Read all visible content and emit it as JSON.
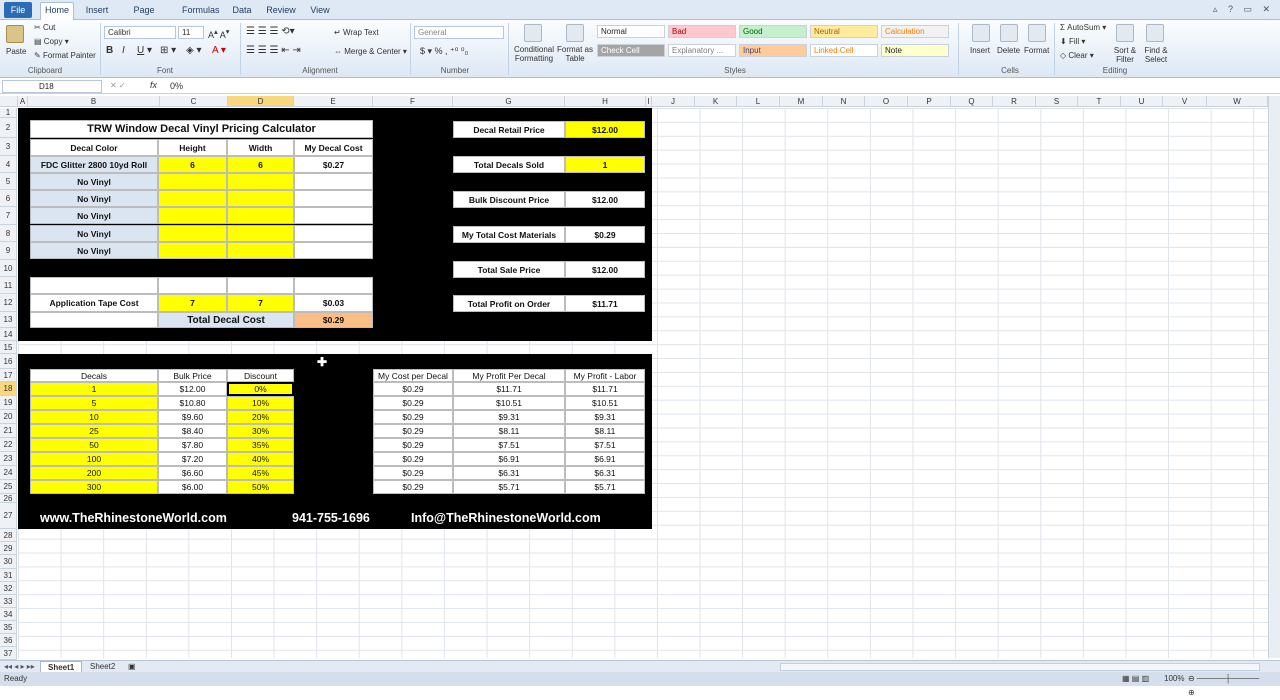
{
  "ribbon_tabs": {
    "file": "File",
    "home": "Home",
    "insert": "Insert",
    "page_layout": "Page Layout",
    "formulas": "Formulas",
    "data": "Data",
    "review": "Review",
    "view": "View"
  },
  "ribbon": {
    "paste": "Paste",
    "cut": "Cut",
    "copy": "Copy",
    "format_painter": "Format Painter",
    "clipboard": "Clipboard",
    "font_name": "Calibri",
    "font_size": "11",
    "font": "Font",
    "alignment": "Alignment",
    "wrap_text": "Wrap Text",
    "merge_center": "Merge & Center",
    "number_format": "General",
    "number": "Number",
    "cond_format": "Conditional Formatting",
    "format_table": "Format as Table",
    "styles_list": [
      {
        "label": "Normal",
        "bg": "#ffffff",
        "color": "#222"
      },
      {
        "label": "Bad",
        "bg": "#ffc7ce",
        "color": "#9c0006"
      },
      {
        "label": "Good",
        "bg": "#c6efce",
        "color": "#006100"
      },
      {
        "label": "Neutral",
        "bg": "#ffeb9c",
        "color": "#9c6500"
      },
      {
        "label": "Calculation",
        "bg": "#f2f2f2",
        "color": "#fa7d00"
      },
      {
        "label": "Check Cell",
        "bg": "#a5a5a5",
        "color": "#ffffff"
      },
      {
        "label": "Explanatory ...",
        "bg": "#ffffff",
        "color": "#7f7f7f"
      },
      {
        "label": "Input",
        "bg": "#ffcc99",
        "color": "#3f3f76"
      },
      {
        "label": "Linked Cell",
        "bg": "#ffffff",
        "color": "#fa7d00"
      },
      {
        "label": "Note",
        "bg": "#ffffcc",
        "color": "#222"
      }
    ],
    "styles": "Styles",
    "insert": "Insert",
    "delete": "Delete",
    "format": "Format",
    "cells": "Cells",
    "autosum": "AutoSum",
    "fill": "Fill",
    "clear": "Clear",
    "sort_filter": "Sort & Filter",
    "find_select": "Find & Select",
    "editing": "Editing"
  },
  "formula_bar": {
    "name_box": "D18",
    "fx": "fx",
    "value": "0%"
  },
  "columns": [
    "A",
    "B",
    "C",
    "D",
    "E",
    "F",
    "G",
    "H",
    "I",
    "J",
    "K",
    "L",
    "M",
    "N",
    "O",
    "P",
    "Q",
    "R",
    "S",
    "T",
    "U",
    "V",
    "W"
  ],
  "rows": [
    "1",
    "2",
    "3",
    "4",
    "5",
    "6",
    "7",
    "8",
    "9",
    "10",
    "11",
    "12",
    "13",
    "14",
    "15",
    "16",
    "17",
    "18",
    "19",
    "20",
    "21",
    "22",
    "23",
    "24",
    "25",
    "26",
    "27",
    "28",
    "29",
    "30",
    "31",
    "32",
    "33",
    "34",
    "35",
    "36",
    "37"
  ],
  "calc": {
    "title": "TRW Window Decal Vinyl Pricing Calculator",
    "headers": [
      "Decal Color",
      "Height",
      "Width",
      "My Decal Cost"
    ],
    "rows": [
      [
        "FDC Glitter 2800 10yd Roll",
        "6",
        "6",
        "$0.27"
      ],
      [
        "No Vinyl",
        "",
        "",
        ""
      ],
      [
        "No Vinyl",
        "",
        "",
        ""
      ],
      [
        "No Vinyl",
        "",
        "",
        ""
      ],
      [
        "No Vinyl",
        "",
        "",
        ""
      ],
      [
        "No Vinyl",
        "",
        "",
        ""
      ]
    ],
    "app_tape": [
      "Application Tape Cost",
      "7",
      "7",
      "$0.03"
    ],
    "total_label": "Total Decal Cost",
    "total_value": "$0.29"
  },
  "summary": [
    {
      "label": "Decal Retail Price",
      "value": "$12.00",
      "hl": true
    },
    {
      "label": "Total Decals Sold",
      "value": "1",
      "hl": true
    },
    {
      "label": "Bulk Discount Price",
      "value": "$12.00",
      "hl": false
    },
    {
      "label": "My Total Cost Materials",
      "value": "$0.29",
      "hl": false
    },
    {
      "label": "Total Sale Price",
      "value": "$12.00",
      "hl": false
    },
    {
      "label": "Total Profit on Order",
      "value": "$11.71",
      "hl": false
    }
  ],
  "bulk": {
    "headers": [
      "Decals",
      "Bulk Price",
      "Discount"
    ],
    "rows": [
      [
        "1",
        "$12.00",
        "0%"
      ],
      [
        "5",
        "$10.80",
        "10%"
      ],
      [
        "10",
        "$9.60",
        "20%"
      ],
      [
        "25",
        "$8.40",
        "30%"
      ],
      [
        "50",
        "$7.80",
        "35%"
      ],
      [
        "100",
        "$7.20",
        "40%"
      ],
      [
        "200",
        "$6.60",
        "45%"
      ],
      [
        "300",
        "$6.00",
        "50%"
      ]
    ]
  },
  "profit": {
    "headers": [
      "My Cost per Decal",
      "My Profit Per Decal",
      "My Profit - Labor"
    ],
    "rows": [
      [
        "$0.29",
        "$11.71",
        "$11.71"
      ],
      [
        "$0.29",
        "$10.51",
        "$10.51"
      ],
      [
        "$0.29",
        "$9.31",
        "$9.31"
      ],
      [
        "$0.29",
        "$8.11",
        "$8.11"
      ],
      [
        "$0.29",
        "$7.51",
        "$7.51"
      ],
      [
        "$0.29",
        "$6.91",
        "$6.91"
      ],
      [
        "$0.29",
        "$6.31",
        "$6.31"
      ],
      [
        "$0.29",
        "$5.71",
        "$5.71"
      ]
    ]
  },
  "footer": {
    "site": "www.TheRhinestoneWorld.com",
    "phone": "941-755-1696",
    "email": "Info@TheRhinestoneWorld.com"
  },
  "sheets": [
    "Sheet1",
    "Sheet2"
  ],
  "status": {
    "ready": "Ready",
    "zoom": "100%"
  }
}
